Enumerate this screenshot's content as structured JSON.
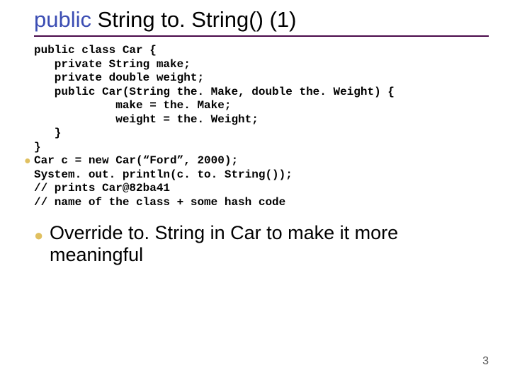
{
  "title": {
    "kw": "public",
    "rest": " String to. String()  (1)"
  },
  "code": {
    "l1": "public class Car {",
    "l2": "   private String make;",
    "l3": "   private double weight;",
    "l4": "   public Car(String the. Make, double the. Weight) {",
    "l5": "            make = the. Make;",
    "l6": "            weight = the. Weight;",
    "l7": "   }",
    "l8": "}",
    "l9": "Car c = new Car(“Ford”, 2000);",
    "l10": "System. out. println(c. to. String());",
    "l11": "// prints Car@82ba41",
    "l12": "// name of the class + some hash code"
  },
  "body": "Override to. String in Car to make it more meaningful",
  "page": "3"
}
